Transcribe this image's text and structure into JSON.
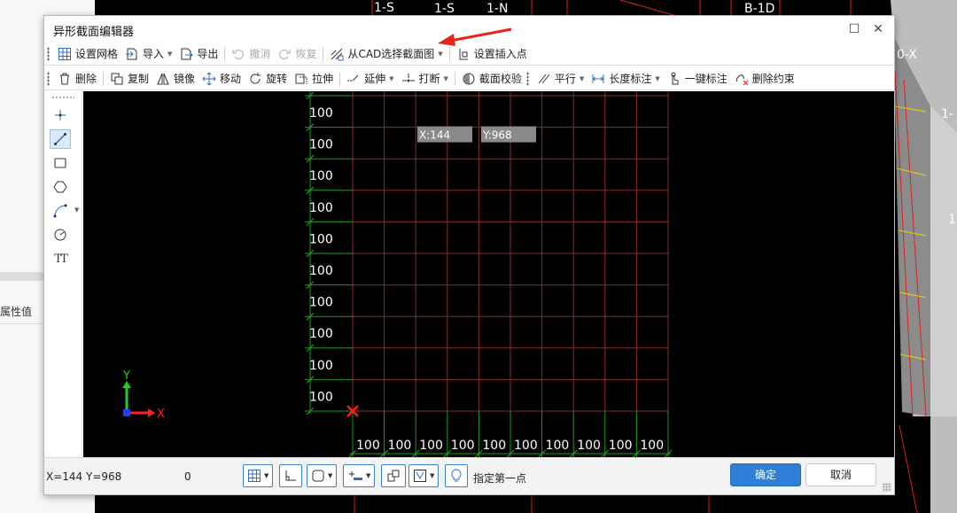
{
  "dialog": {
    "title": "异形截面编辑器",
    "maximize_glyph": "☐",
    "close_glyph": "✕"
  },
  "toolbar1": {
    "set_grid": "设置网格",
    "import": "导入",
    "export": "导出",
    "undo": "撤消",
    "redo": "恢复",
    "select_from_cad": "从CAD选择截面图",
    "set_insert_point": "设置插入点"
  },
  "toolbar2": {
    "delete": "删除",
    "copy": "复制",
    "mirror": "镜像",
    "move": "移动",
    "rotate": "旋转",
    "stretch": "拉伸",
    "extend": "延伸",
    "break": "打断",
    "section_check": "截面校验",
    "parallel": "平行",
    "length_dim": "长度标注",
    "one_click_dim": "一键标注",
    "delete_constraint": "删除约束"
  },
  "sidebar": {
    "tools": [
      "point-tool",
      "line-tool",
      "rectangle-tool",
      "polygon-tool",
      "arc-tool",
      "circle-tool",
      "text-tool"
    ],
    "active": "line-tool",
    "text_tool_glyph": "TT"
  },
  "canvas": {
    "grid_rows": 10,
    "grid_cols": 10,
    "row_labels": [
      "100",
      "100",
      "100",
      "100",
      "100",
      "100",
      "100",
      "100",
      "100",
      "100"
    ],
    "col_labels": [
      "100",
      "100",
      "100",
      "100",
      "100",
      "100",
      "100",
      "100",
      "100",
      "100"
    ],
    "cursor_x_label": "X:144",
    "cursor_y_label": "Y:968",
    "axis_x_label": "X",
    "axis_y_label": "Y",
    "colors": {
      "grid": "#8b2a2a",
      "dimension": "#1f9a1f",
      "label": "#ffffff",
      "origin_marker": "#ff1a1a",
      "axis_x": "#ff2020",
      "axis_y": "#20d020",
      "axis_origin": "#1f3fff",
      "tooltip_bg": "#8a8a8a"
    }
  },
  "status": {
    "coords": "X=144 Y=968",
    "zero": "0",
    "prompt": "指定第一点",
    "ok": "确定",
    "cancel": "取消"
  },
  "background": {
    "panel_label": "属性值",
    "labels": [
      "1-S",
      "1-N",
      "B-1D",
      "1-S",
      "0-X",
      "1-",
      "1"
    ]
  }
}
